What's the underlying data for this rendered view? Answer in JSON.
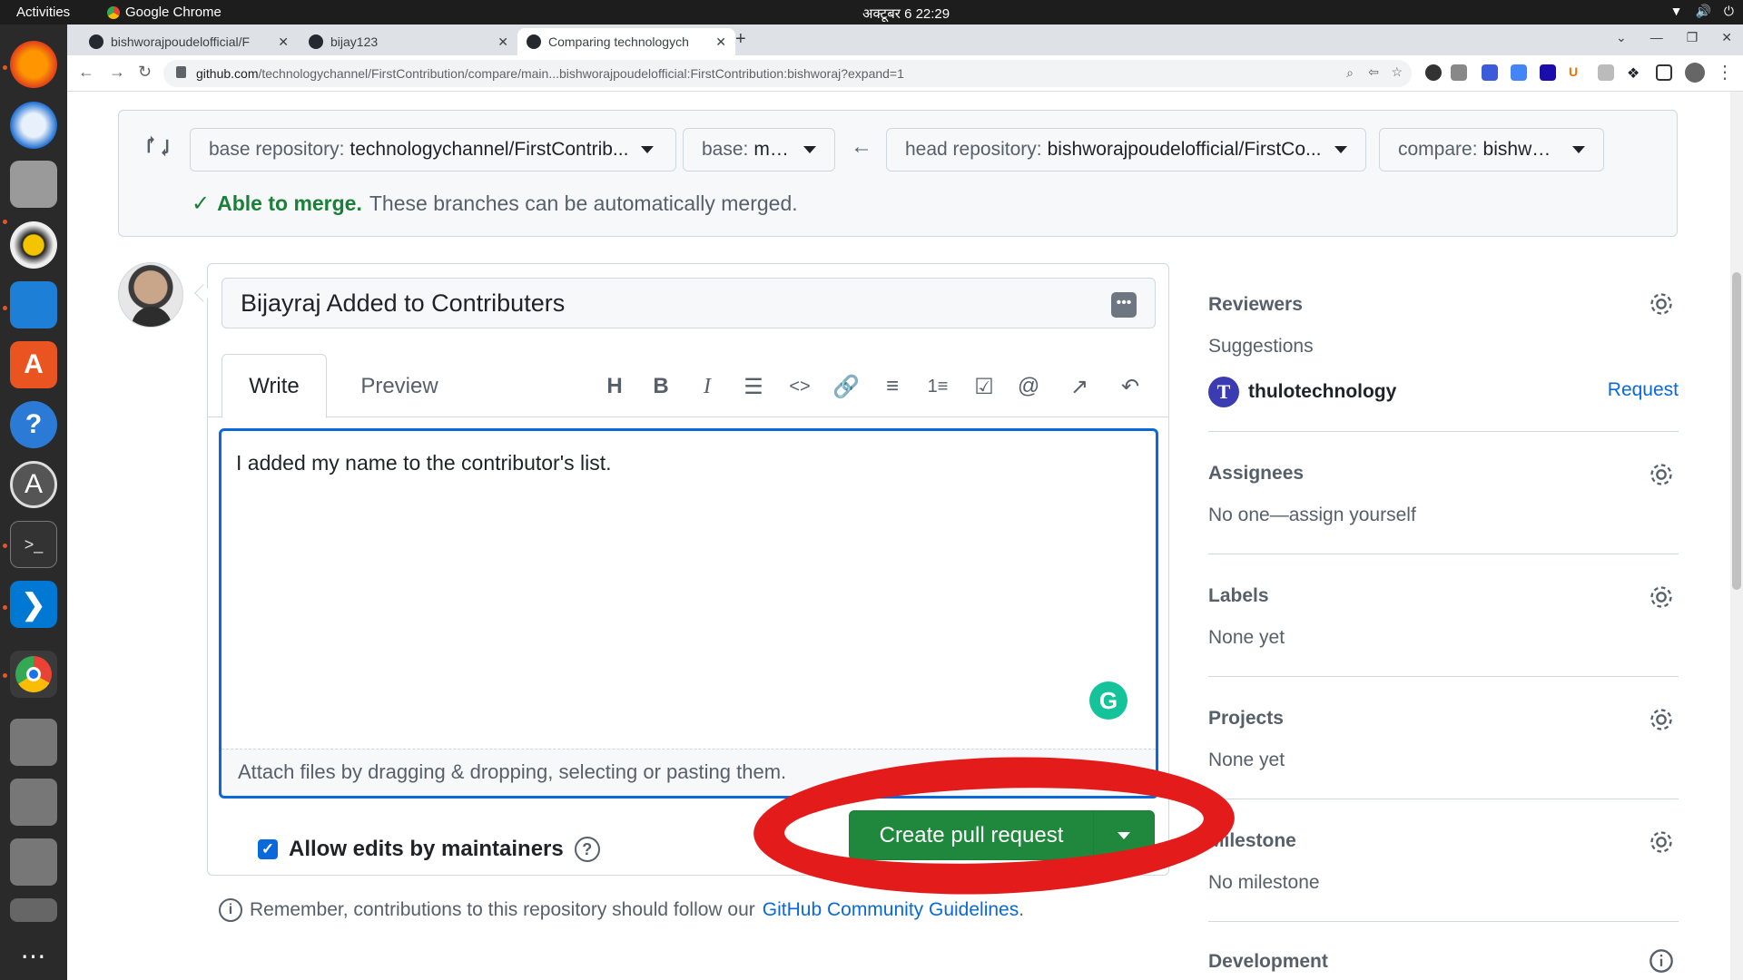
{
  "os": {
    "activities": "Activities",
    "app_name": "Google Chrome",
    "clock": "अक्टूबर 6  22:29"
  },
  "browser": {
    "tabs": [
      {
        "label": "bishworajpoudelofficial/F"
      },
      {
        "label": "bijay123"
      },
      {
        "label": "Comparing technologych"
      }
    ],
    "url_host": "github.com",
    "url_path": "/technologychannel/FirstContribution/compare/main...bishworajpoudelofficial:FirstContribution:bishworaj?expand=1"
  },
  "compare": {
    "base_repo_label": "base repository:",
    "base_repo_value": "technologychannel/FirstContrib...",
    "base_label": "base:",
    "base_value": "main",
    "head_repo_label": "head repository:",
    "head_repo_value": "bishworajpoudelofficial/FirstCo...",
    "compare_label": "compare:",
    "compare_value": "bishworaj",
    "merge_ok": "Able to merge.",
    "merge_text": "These branches can be automatically merged."
  },
  "form": {
    "title_value": "Bijayraj Added to Contributers",
    "tab_write": "Write",
    "tab_preview": "Preview",
    "body_value": "I added my name to the contributor's list.",
    "attach_hint": "Attach files by dragging & dropping, selecting or pasting them.",
    "allow_edits": "Allow edits by maintainers",
    "create_button": "Create pull request"
  },
  "footer": {
    "remember_text": "Remember, contributions to this repository should follow our",
    "guidelines_link": "GitHub Community Guidelines",
    "period": "."
  },
  "sidebar": {
    "reviewers": {
      "title": "Reviewers",
      "suggestions": "Suggestions",
      "user": "thulotechnology",
      "request": "Request"
    },
    "assignees": {
      "title": "Assignees",
      "value": "No one—assign yourself"
    },
    "labels": {
      "title": "Labels",
      "value": "None yet"
    },
    "projects": {
      "title": "Projects",
      "value": "None yet"
    },
    "milestone": {
      "title": "Milestone",
      "value": "No milestone"
    },
    "development": {
      "title": "Development"
    }
  },
  "colors": {
    "accent": "#0969da",
    "success": "#1f883d",
    "annotation": "#e31b1b"
  }
}
